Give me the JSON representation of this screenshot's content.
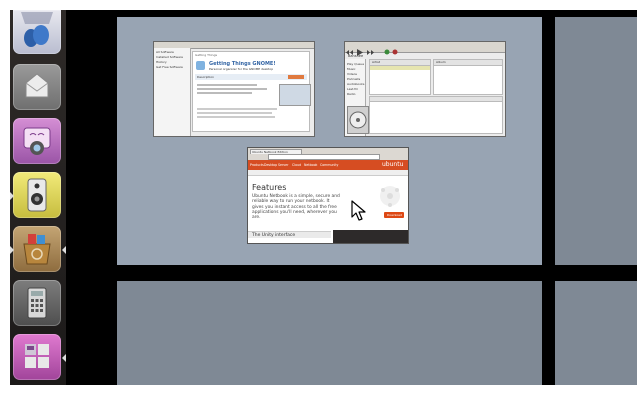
{
  "launcher": {
    "items": [
      {
        "name": "trash-icon",
        "color": "#3c6fb8"
      },
      {
        "name": "mail-icon",
        "color": "#7a7a7a"
      },
      {
        "name": "webcam-icon",
        "color": "#b06cb8"
      },
      {
        "name": "speaker-icon",
        "color": "#c7c04a"
      },
      {
        "name": "software-center-icon",
        "color": "#9c7c4a"
      },
      {
        "name": "calculator-icon",
        "color": "#6e6e6e"
      },
      {
        "name": "workspace-switcher-icon",
        "color": "#c05cb0"
      }
    ]
  },
  "windows": {
    "gtg_window": {
      "title": "Getting Things GNOME!",
      "subtitle": "Personal organizer for the GNOME desktop",
      "tab_label": "Getting Things",
      "sidebar": [
        "All Software",
        "Installed Software",
        "History",
        "Get Free Software"
      ],
      "section_label": "Description"
    },
    "player_window": {
      "title": "Banshee",
      "sidebar": [
        "Play Queue",
        "Music",
        "Videos",
        "Podcasts",
        "Audiobooks",
        "Last.fm",
        "Radio"
      ],
      "browser_header": "Artist",
      "album_header": "Album"
    },
    "browser_window": {
      "tab_label": "Ubuntu Netbook Edition",
      "nav_logo": "ubuntu",
      "nav_items": [
        "Products",
        "Desktop",
        "Server",
        "Cloud",
        "Netbook",
        "Community"
      ],
      "feature_title": "Features",
      "feature_text": "Ubuntu Netbook is a simple, secure and reliable way to run your netbook. It gives you instant access to all the free applications you'll need, wherever you are.",
      "section_heading": "The Unity interface",
      "download_label": "Download"
    }
  }
}
